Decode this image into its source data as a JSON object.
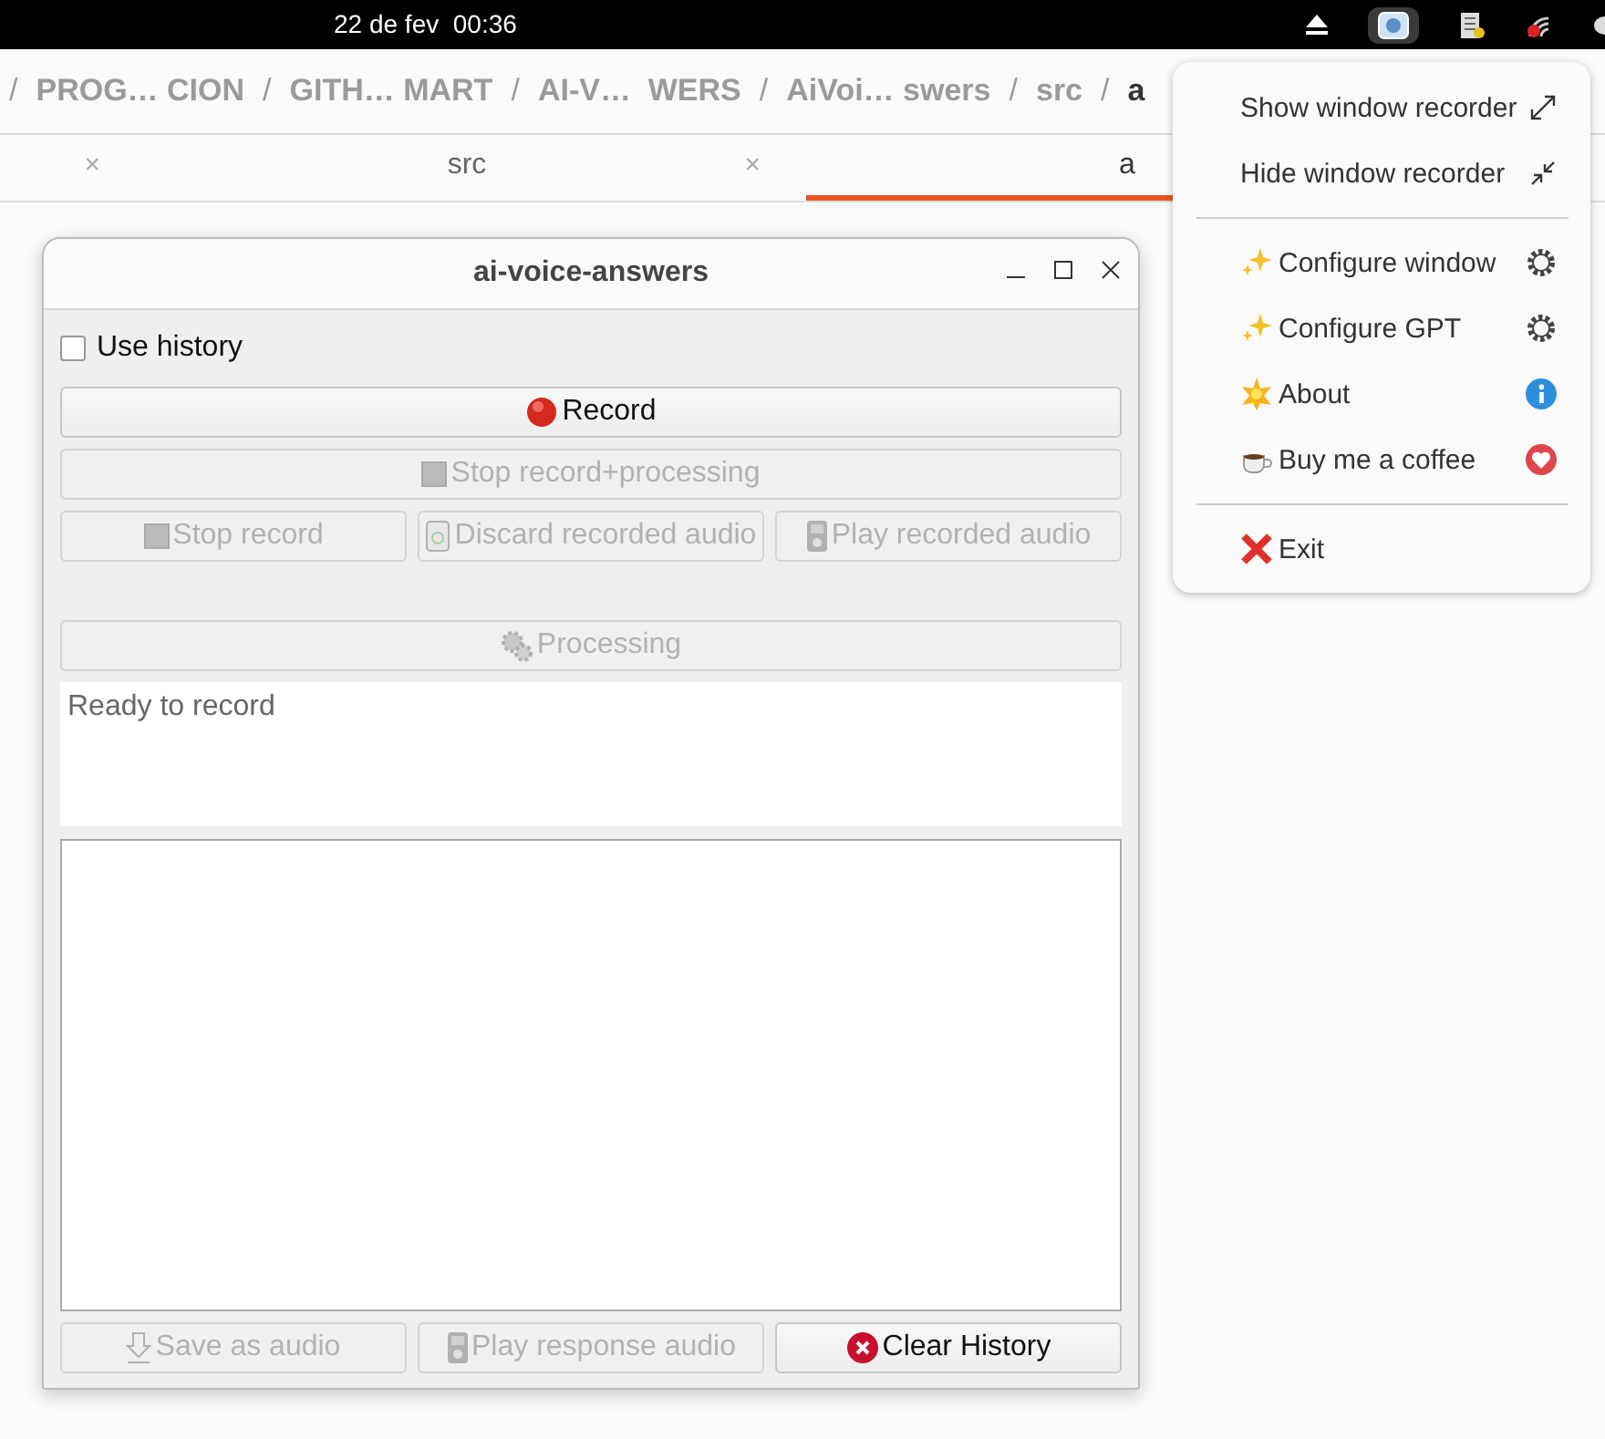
{
  "top_bar": {
    "clock": "22 de fev  00:36"
  },
  "path_bar": {
    "crumbs": [
      {
        "kind": "separator",
        "text": "/"
      },
      {
        "kind": "crumb",
        "text": "PROG… CION",
        "selected": false
      },
      {
        "kind": "separator",
        "text": "/"
      },
      {
        "kind": "crumb",
        "text": "GITH… MART",
        "selected": false
      },
      {
        "kind": "separator",
        "text": "/"
      },
      {
        "kind": "crumb",
        "text": "AI-V…  WERS",
        "selected": false
      },
      {
        "kind": "separator",
        "text": "/"
      },
      {
        "kind": "crumb",
        "text": "AiVoi… swers",
        "selected": false
      },
      {
        "kind": "separator",
        "text": "/"
      },
      {
        "kind": "crumb",
        "text": "src",
        "selected": false
      },
      {
        "kind": "separator",
        "text": "/"
      },
      {
        "kind": "crumb",
        "text": "a",
        "selected": true
      }
    ]
  },
  "tabs": [
    {
      "close": "×",
      "selected": false
    },
    {
      "label": "src",
      "close": "×",
      "selected": false
    },
    {
      "label": "a",
      "selected": true
    }
  ],
  "window": {
    "title": "ai-voice-answers",
    "use_history": {
      "label": "Use history",
      "checked": false
    },
    "rows": [
      [
        {
          "label": "Record",
          "kind": "record",
          "disabled": false
        }
      ],
      [
        {
          "label": "Stop record+processing",
          "kind": "stop",
          "disabled": true
        }
      ],
      [
        {
          "label": "Stop record",
          "kind": "stop",
          "disabled": true
        },
        {
          "label": "Discard recorded audio",
          "kind": "discard",
          "disabled": true
        },
        {
          "label": "Play recorded audio",
          "kind": "play",
          "disabled": true
        }
      ],
      [
        {
          "label": "Processing",
          "kind": "process",
          "disabled": true
        }
      ]
    ],
    "status": "Ready to record",
    "bottom_buttons": [
      {
        "label": "Save as audio",
        "kind": "save",
        "disabled": true
      },
      {
        "label": "Play response audio",
        "kind": "play",
        "disabled": true
      },
      {
        "label": "Clear History",
        "kind": "clear",
        "disabled": false
      }
    ]
  },
  "menu": {
    "items": [
      {
        "kind": "show",
        "label": "Show window recorder"
      },
      {
        "kind": "hide",
        "label": "Hide window recorder"
      },
      {
        "kind": "separator"
      },
      {
        "kind": "configure",
        "label": "Configure window"
      },
      {
        "kind": "configure",
        "label": "Configure GPT"
      },
      {
        "kind": "about",
        "label": "About"
      },
      {
        "kind": "donate",
        "label": "Buy me a coffee"
      },
      {
        "kind": "separator"
      },
      {
        "kind": "exit",
        "label": "Exit"
      }
    ]
  }
}
